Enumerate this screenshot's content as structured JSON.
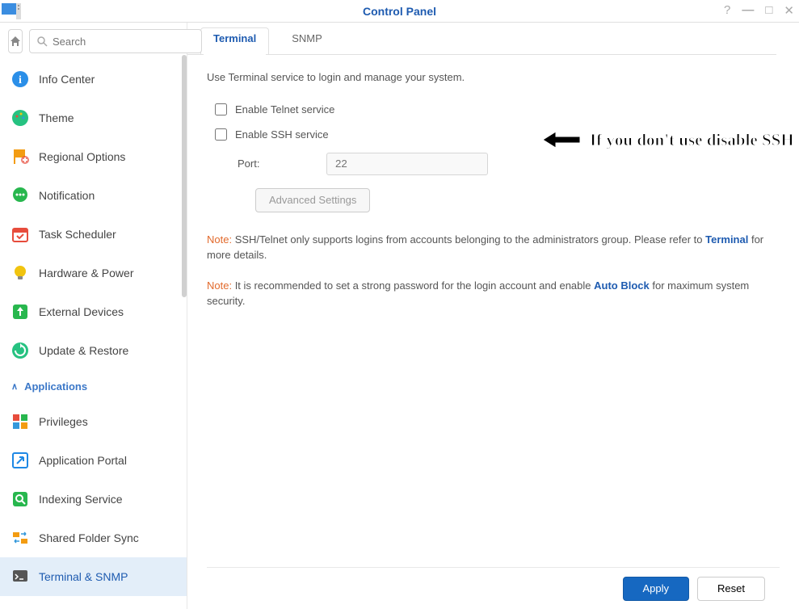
{
  "titlebar": {
    "title": "Control Panel"
  },
  "search": {
    "placeholder": "Search"
  },
  "sidebar": {
    "items": [
      {
        "label": "Info Center"
      },
      {
        "label": "Theme"
      },
      {
        "label": "Regional Options"
      },
      {
        "label": "Notification"
      },
      {
        "label": "Task Scheduler"
      },
      {
        "label": "Hardware & Power"
      },
      {
        "label": "External Devices"
      },
      {
        "label": "Update & Restore"
      }
    ],
    "section_header": "Applications",
    "app_items": [
      {
        "label": "Privileges"
      },
      {
        "label": "Application Portal"
      },
      {
        "label": "Indexing Service"
      },
      {
        "label": "Shared Folder Sync"
      },
      {
        "label": "Terminal & SNMP"
      }
    ]
  },
  "tabs": {
    "tab1": "Terminal",
    "tab2": "SNMP"
  },
  "content": {
    "intro": "Use Terminal service to login and manage your system.",
    "check_telnet": "Enable Telnet service",
    "check_ssh": "Enable SSH service",
    "port_label": "Port:",
    "port_value": "22",
    "advanced": "Advanced Settings",
    "note1_label": "Note:",
    "note1_text1": " SSH/Telnet only supports logins from accounts belonging to the administrators group. Please refer to ",
    "note1_link": "Terminal",
    "note1_text2": " for more details.",
    "note2_label": "Note:",
    "note2_text1": " It is recommended to set a strong password for the login account and enable ",
    "note2_link": "Auto Block",
    "note2_text2": " for maximum system security."
  },
  "footer": {
    "apply": "Apply",
    "reset": "Reset"
  },
  "annotation": {
    "text": "If you don't use disable SSH service"
  }
}
